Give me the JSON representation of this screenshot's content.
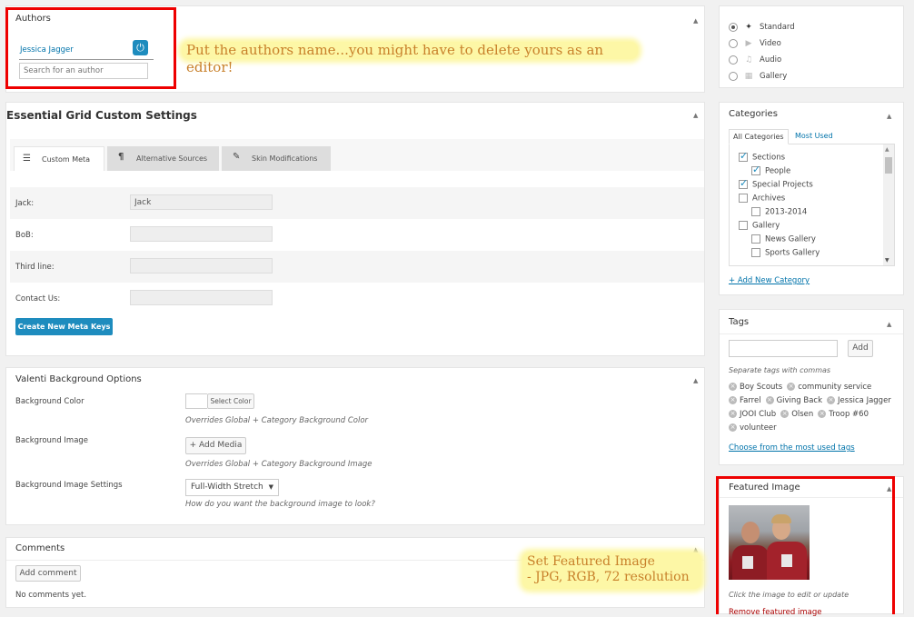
{
  "authors": {
    "title": "Authors",
    "author_name": "Jessica Jagger",
    "search_placeholder": "Search for an author",
    "annotation": "Put the authors name...you might have to delete yours as an editor!"
  },
  "format": {
    "options": [
      {
        "label": "Standard",
        "icon": "pushpin-icon",
        "checked": true
      },
      {
        "label": "Video",
        "icon": "video-icon",
        "checked": false
      },
      {
        "label": "Audio",
        "icon": "audio-icon",
        "checked": false
      },
      {
        "label": "Gallery",
        "icon": "gallery-icon",
        "checked": false
      }
    ]
  },
  "essential_grid": {
    "title": "Essential Grid Custom Settings",
    "tabs": [
      {
        "label": "Custom Meta",
        "icon": "list-icon"
      },
      {
        "label": "Alternative Sources",
        "icon": "sources-icon"
      },
      {
        "label": "Skin Modifications",
        "icon": "pin-icon"
      }
    ],
    "fields": [
      {
        "label": "Jack:",
        "value": "Jack"
      },
      {
        "label": "BoB:",
        "value": ""
      },
      {
        "label": "Third line:",
        "value": ""
      },
      {
        "label": "Contact Us:",
        "value": ""
      }
    ],
    "create_button": "Create New Meta Keys"
  },
  "valenti": {
    "title": "Valenti Background Options",
    "bg_color_label": "Background Color",
    "select_color": "Select Color",
    "color_note": "Overrides Global + Category Background Color",
    "bg_image_label": "Background Image",
    "add_media": "+ Add Media",
    "image_note": "Overrides Global + Category Background Image",
    "settings_label": "Background Image Settings",
    "settings_value": "Full-Width Stretch",
    "settings_note": "How do you want the background image to look?"
  },
  "comments": {
    "title": "Comments",
    "add_button": "Add comment",
    "empty": "No comments yet.",
    "annotation_line1": "Set Featured Image",
    "annotation_line2": "- JPG, RGB, 72 resolution"
  },
  "categories": {
    "title": "Categories",
    "tab_all": "All Categories",
    "tab_used": "Most Used",
    "items": [
      {
        "label": "Sections",
        "checked": true,
        "indent": 0
      },
      {
        "label": "People",
        "checked": true,
        "indent": 1
      },
      {
        "label": "Special Projects",
        "checked": true,
        "indent": 0
      },
      {
        "label": "Archives",
        "checked": false,
        "indent": 0
      },
      {
        "label": "2013-2014",
        "checked": false,
        "indent": 1
      },
      {
        "label": "Gallery",
        "checked": false,
        "indent": 0
      },
      {
        "label": "News Gallery",
        "checked": false,
        "indent": 1
      },
      {
        "label": "Sports Gallery",
        "checked": false,
        "indent": 1
      }
    ],
    "add_new": "+ Add New Category"
  },
  "tags": {
    "title": "Tags",
    "add_button": "Add",
    "hint": "Separate tags with commas",
    "items": [
      "Boy Scouts",
      "community service",
      "Farrel",
      "Giving Back",
      "Jessica Jagger",
      "JOOI Club",
      "Olsen",
      "Troop #60",
      "volunteer"
    ],
    "choose_link": "Choose from the most used tags"
  },
  "featured": {
    "title": "Featured Image",
    "hint": "Click the image to edit or update",
    "remove": "Remove featured image"
  },
  "colors": {
    "accent": "#1e8cbe",
    "annotation_border": "#e00000",
    "highlight": "#fdf7a6"
  }
}
